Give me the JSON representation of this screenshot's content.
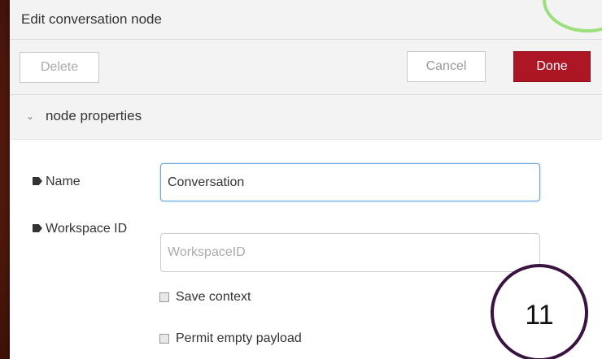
{
  "dialog": {
    "title": "Edit conversation node"
  },
  "toolbar": {
    "delete_label": "Delete",
    "cancel_label": "Cancel",
    "done_label": "Done"
  },
  "section": {
    "chevron": "⌄",
    "label": "node properties"
  },
  "fields": {
    "name": {
      "label": "Name",
      "value": "Conversation",
      "icon": "tag-icon"
    },
    "workspace": {
      "label": "Workspace ID",
      "value": "",
      "placeholder": "WorkspaceID",
      "icon": "tag-icon"
    }
  },
  "checkboxes": [
    {
      "label": "Save context",
      "checked": false
    },
    {
      "label": "Permit empty payload",
      "checked": false
    }
  ],
  "annotation": {
    "number": "11"
  },
  "colors": {
    "done_button": "#ad1625",
    "background": "#5a1c0e",
    "annotation_ring": "#3a1440",
    "highlight_ring": "#9be07a"
  }
}
